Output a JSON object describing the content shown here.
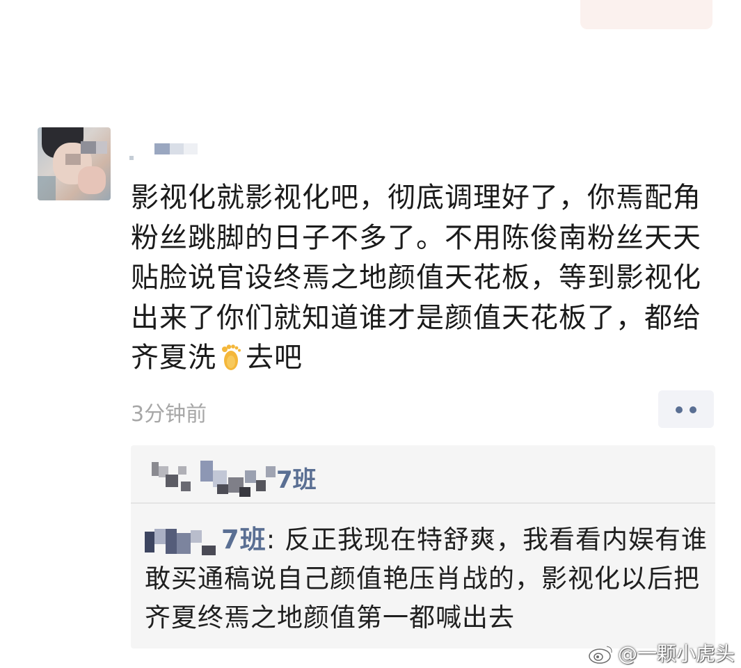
{
  "post": {
    "avatar_icon": "user-avatar-blurred",
    "username": "",
    "body_before_emoji": "影视化就影视化吧，彻底调理好了，你焉配角粉丝跳脚的日子不多了。不用陈俊南粉丝天天贴脸说官设终焉之地颜值天花板，等到影视化出来了你们就知道谁才是颜值天花板了，都给齐夏洗",
    "emoji": "foot-emoji",
    "body_after_emoji": "去吧",
    "time_ago": "3分钟前",
    "more_icon": "more-dots-icon"
  },
  "comment_section": {
    "like_name_suffix": "7班",
    "comment": {
      "author_suffix": "7班",
      "separator": ": ",
      "text": "反正我现在特舒爽，我看看内娱有谁敢买通稿说自己颜值艳压肖战的，影视化以后把齐夏终焉之地颜值第一都喊出去"
    }
  },
  "watermark": {
    "icon": "weibo-logo-icon",
    "text": "@一颗小虎头"
  },
  "colors": {
    "link_blue": "#5a6f93",
    "text": "#1a1a1a",
    "muted": "#a7a7a7",
    "comment_bg": "#f5f5f5"
  }
}
